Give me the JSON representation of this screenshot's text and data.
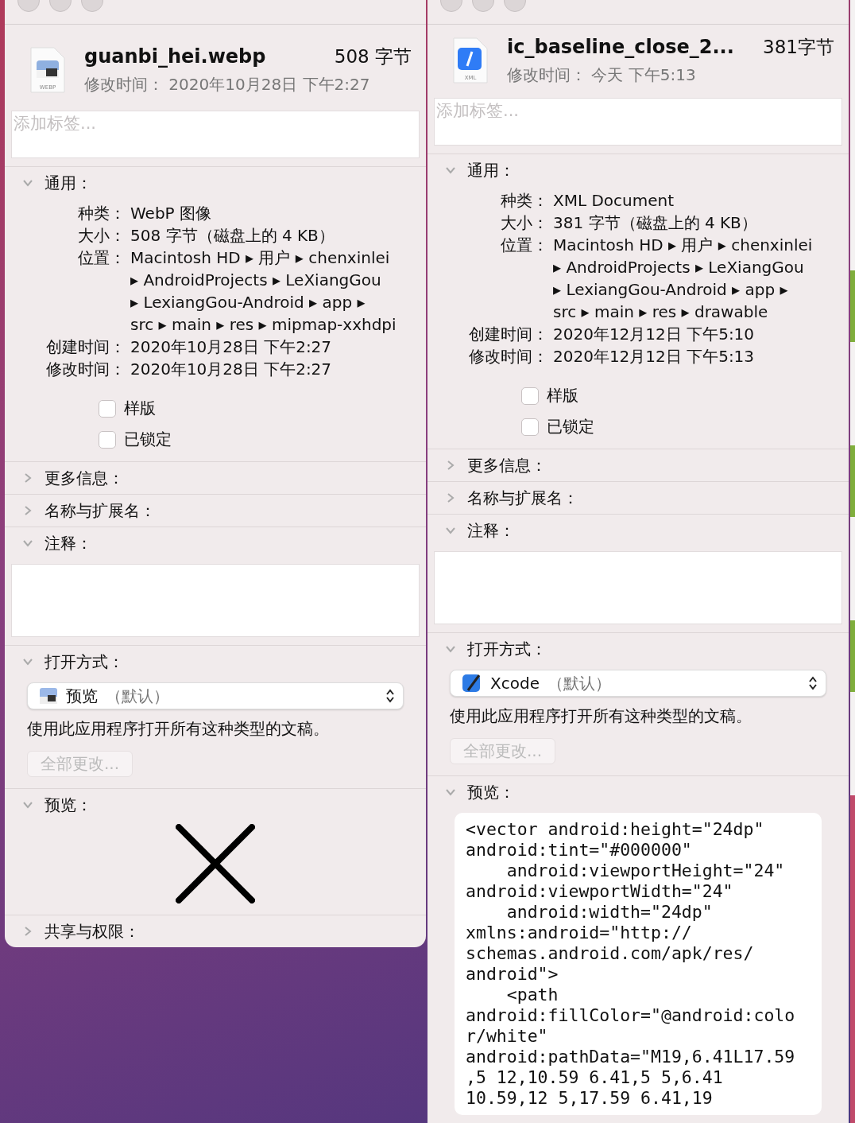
{
  "windows": [
    {
      "file_name": "guanbi_hei.webp",
      "size": "508 字节",
      "icon": {
        "kind": "webp",
        "label": "WEBP"
      },
      "modified_label": "修改时间：",
      "modified": "2020年10月28日 下午2:27",
      "tags_placeholder": "添加标签...",
      "sections": [
        {
          "kind": "general",
          "title": "通用：",
          "expanded": true,
          "rows": [
            {
              "label": "种类：",
              "lines": [
                "WebP 图像"
              ]
            },
            {
              "label": "大小：",
              "lines": [
                "508 字节（磁盘上的 4 KB）"
              ]
            },
            {
              "label": "位置：",
              "lines": [
                "Macintosh HD ▸ 用户 ▸ chenxinlei",
                "▸ AndroidProjects ▸ LeXiangGou",
                "▸ LexiangGou-Android ▸ app ▸",
                "src ▸ main ▸ res ▸ mipmap-xxhdpi"
              ]
            },
            {
              "label": "创建时间：",
              "lines": [
                "2020年10月28日 下午2:27"
              ]
            },
            {
              "label": "修改时间：",
              "lines": [
                "2020年10月28日 下午2:27"
              ]
            }
          ],
          "checkboxes": [
            {
              "label": "样版",
              "checked": false
            },
            {
              "label": "已锁定",
              "checked": false
            }
          ]
        },
        {
          "kind": "plain",
          "title": "更多信息：",
          "expanded": false
        },
        {
          "kind": "plain",
          "title": "名称与扩展名：",
          "expanded": false
        },
        {
          "kind": "comments",
          "title": "注释：",
          "expanded": true
        },
        {
          "kind": "open_with",
          "title": "打开方式：",
          "expanded": true,
          "app": {
            "kind": "preview",
            "name": "预览",
            "note": "（默认）"
          },
          "description": "使用此应用程序打开所有这种类型的文稿。",
          "button": "全部更改...",
          "button_disabled": true
        },
        {
          "kind": "preview",
          "title": "预览：",
          "expanded": true
        },
        {
          "kind": "plain",
          "title": "共享与权限：",
          "expanded": false
        }
      ]
    },
    {
      "file_name": "ic_baseline_close_2...",
      "size": "381字节",
      "icon": {
        "kind": "xml",
        "label": "XML"
      },
      "modified_label": "修改时间：",
      "modified": "今天 下午5:13",
      "tags_placeholder": "添加标签...",
      "sections": [
        {
          "kind": "general",
          "title": "通用：",
          "expanded": true,
          "rows": [
            {
              "label": "种类：",
              "lines": [
                "XML Document"
              ]
            },
            {
              "label": "大小：",
              "lines": [
                "381 字节（磁盘上的 4 KB）"
              ]
            },
            {
              "label": "位置：",
              "lines": [
                "Macintosh HD ▸ 用户 ▸ chenxinlei",
                "▸ AndroidProjects ▸ LeXiangGou",
                "▸ LexiangGou-Android ▸ app ▸",
                "src ▸ main ▸ res ▸ drawable"
              ]
            },
            {
              "label": "创建时间：",
              "lines": [
                "2020年12月12日 下午5:10"
              ]
            },
            {
              "label": "修改时间：",
              "lines": [
                "2020年12月12日 下午5:13"
              ]
            }
          ],
          "checkboxes": [
            {
              "label": "样版",
              "checked": false
            },
            {
              "label": "已锁定",
              "checked": false
            }
          ]
        },
        {
          "kind": "plain",
          "title": "更多信息：",
          "expanded": false
        },
        {
          "kind": "plain",
          "title": "名称与扩展名：",
          "expanded": false
        },
        {
          "kind": "comments",
          "title": "注释：",
          "expanded": true
        },
        {
          "kind": "open_with",
          "title": "打开方式：",
          "expanded": true,
          "app": {
            "kind": "xcode",
            "name": "Xcode",
            "note": "（默认）"
          },
          "description": "使用此应用程序打开所有这种类型的文稿。",
          "button": "全部更改...",
          "button_disabled": true
        },
        {
          "kind": "preview",
          "title": "预览：",
          "expanded": true,
          "content": {
            "kind": "text",
            "lines": [
              "<vector android:height=\"24dp\"",
              "android:tint=\"#000000\"",
              "    android:viewportHeight=\"24\"",
              "android:viewportWidth=\"24\"",
              "    android:width=\"24dp\"",
              "xmlns:android=\"http://",
              "schemas.android.com/apk/res/",
              "android\">",
              "    <path",
              "android:fillColor=\"@android:colo",
              "r/white\"",
              "android:pathData=\"M19,6.41L17.59",
              ",5 12,10.59 6.41,5 5,6.41",
              "10.59,12 5,17.59 6.41,19"
            ]
          }
        }
      ]
    }
  ]
}
